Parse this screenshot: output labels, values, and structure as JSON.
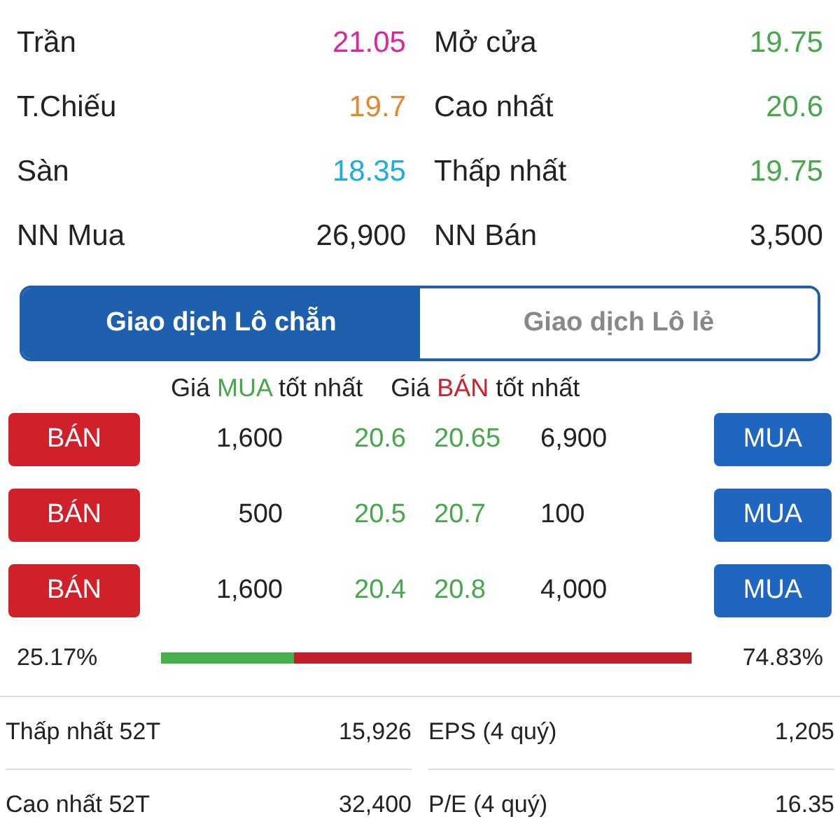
{
  "quote": [
    {
      "label": "Trần",
      "value": "21.05",
      "color": "#e0249a"
    },
    {
      "label": "Mở cửa",
      "value": "19.75",
      "color": "#46a84a"
    },
    {
      "label": "T.Chiếu",
      "value": "19.7",
      "color": "#e4872f"
    },
    {
      "label": "Cao nhất",
      "value": "20.6",
      "color": "#46a84a"
    },
    {
      "label": "Sàn",
      "value": "18.35",
      "color": "#18aee0"
    },
    {
      "label": "Thấp nhất",
      "value": "19.75",
      "color": "#46a84a"
    },
    {
      "label": "NN Mua",
      "value": "26,900",
      "color": "#222222"
    },
    {
      "label": "NN Bán",
      "value": "3,500",
      "color": "#222222"
    }
  ],
  "tabs": [
    {
      "label": "Giao dịch Lô chẵn",
      "selected": true
    },
    {
      "label": "Giao dịch Lô lẻ",
      "selected": false
    }
  ],
  "headers": [
    {
      "prefix": "Giá",
      "side": "MUA",
      "suffix": "tốt nhất",
      "kind": "buy"
    },
    {
      "prefix": "Giá",
      "side": "BÁN",
      "suffix": "tốt nhất",
      "kind": "sell"
    }
  ],
  "orders": [
    {
      "sell_label": "BÁN",
      "bid_qty": "1,600",
      "bid_price": "20.6",
      "ask_price": "20.65",
      "ask_qty": "6,900",
      "buy_label": "MUA"
    },
    {
      "sell_label": "BÁN",
      "bid_qty": "500",
      "bid_price": "20.5",
      "ask_price": "20.7",
      "ask_qty": "100",
      "buy_label": "MUA"
    },
    {
      "sell_label": "BÁN",
      "bid_qty": "1,600",
      "bid_price": "20.4",
      "ask_price": "20.8",
      "ask_qty": "4,000",
      "buy_label": "MUA"
    }
  ],
  "ratio": {
    "buy_pct": "25.17%",
    "sell_pct": "74.83%",
    "level": 0.2517
  },
  "stats": [
    {
      "label": "Thấp nhất 52T",
      "value": "15,926"
    },
    {
      "label": "EPS (4 quý)",
      "value": "1,205"
    },
    {
      "label": "Cao nhất 52T",
      "value": "32,400"
    },
    {
      "label": "P/E (4 quý)",
      "value": "16.35"
    }
  ]
}
